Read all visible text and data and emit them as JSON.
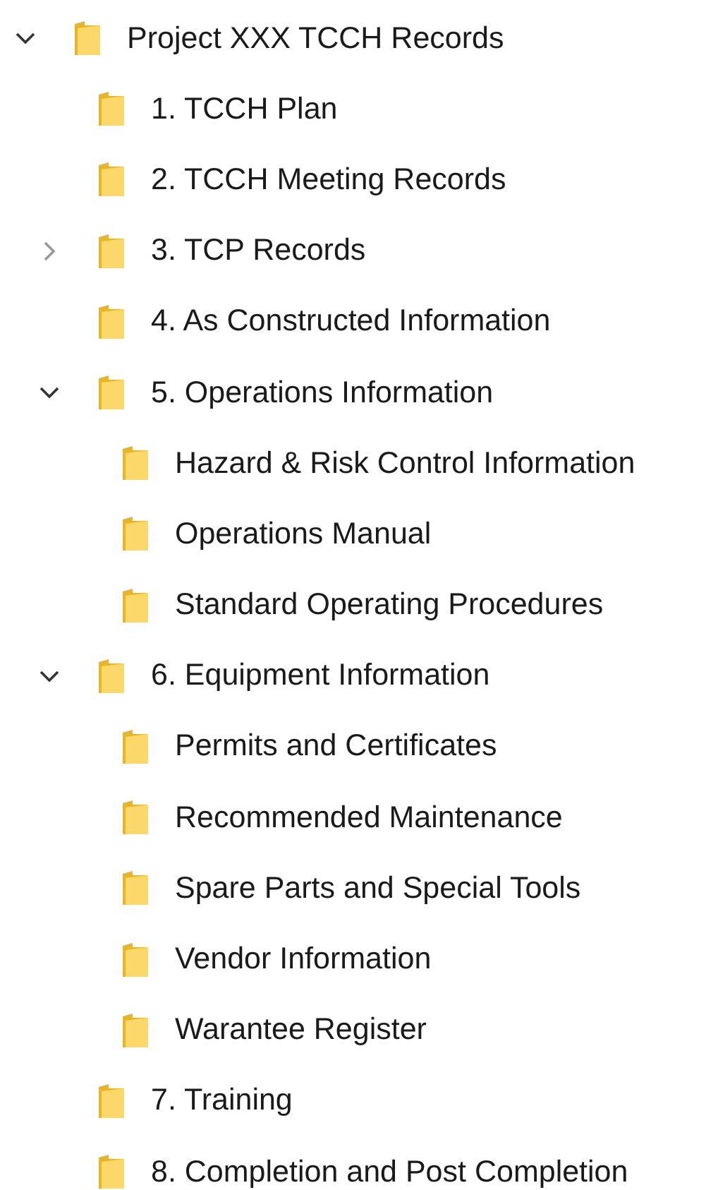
{
  "tree": [
    {
      "label": "Project XXX TCCH Records",
      "expanded": true,
      "children": [
        {
          "label": "1. TCCH Plan"
        },
        {
          "label": "2. TCCH Meeting Records"
        },
        {
          "label": "3. TCP Records",
          "expanded": false
        },
        {
          "label": "4. As Constructed Information"
        },
        {
          "label": "5. Operations Information",
          "expanded": true,
          "children": [
            {
              "label": "Hazard & Risk Control Information"
            },
            {
              "label": "Operations Manual"
            },
            {
              "label": "Standard Operating Procedures"
            }
          ]
        },
        {
          "label": "6. Equipment Information",
          "expanded": true,
          "children": [
            {
              "label": "Permits and Certificates"
            },
            {
              "label": "Recommended Maintenance"
            },
            {
              "label": "Spare Parts and Special Tools"
            },
            {
              "label": "Vendor Information"
            },
            {
              "label": "Warantee Register"
            }
          ]
        },
        {
          "label": "7. Training"
        },
        {
          "label": "8. Completion and Post Completion"
        }
      ]
    }
  ]
}
